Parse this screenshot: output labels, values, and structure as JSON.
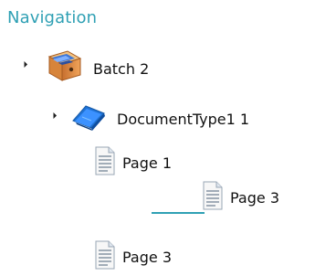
{
  "panel": {
    "title": "Navigation"
  },
  "tree": {
    "batch": {
      "label": "Batch 2",
      "icon": "batch-icon"
    },
    "document": {
      "label": "DocumentType1 1",
      "icon": "document-folder-icon"
    },
    "pages": [
      {
        "label": "Page 1",
        "icon": "page-icon"
      },
      {
        "label": "Page 3",
        "icon": "page-icon"
      }
    ],
    "drag_preview": {
      "label": "Page 3",
      "icon": "page-icon"
    }
  },
  "colors": {
    "accent": "#2fa0b4"
  }
}
